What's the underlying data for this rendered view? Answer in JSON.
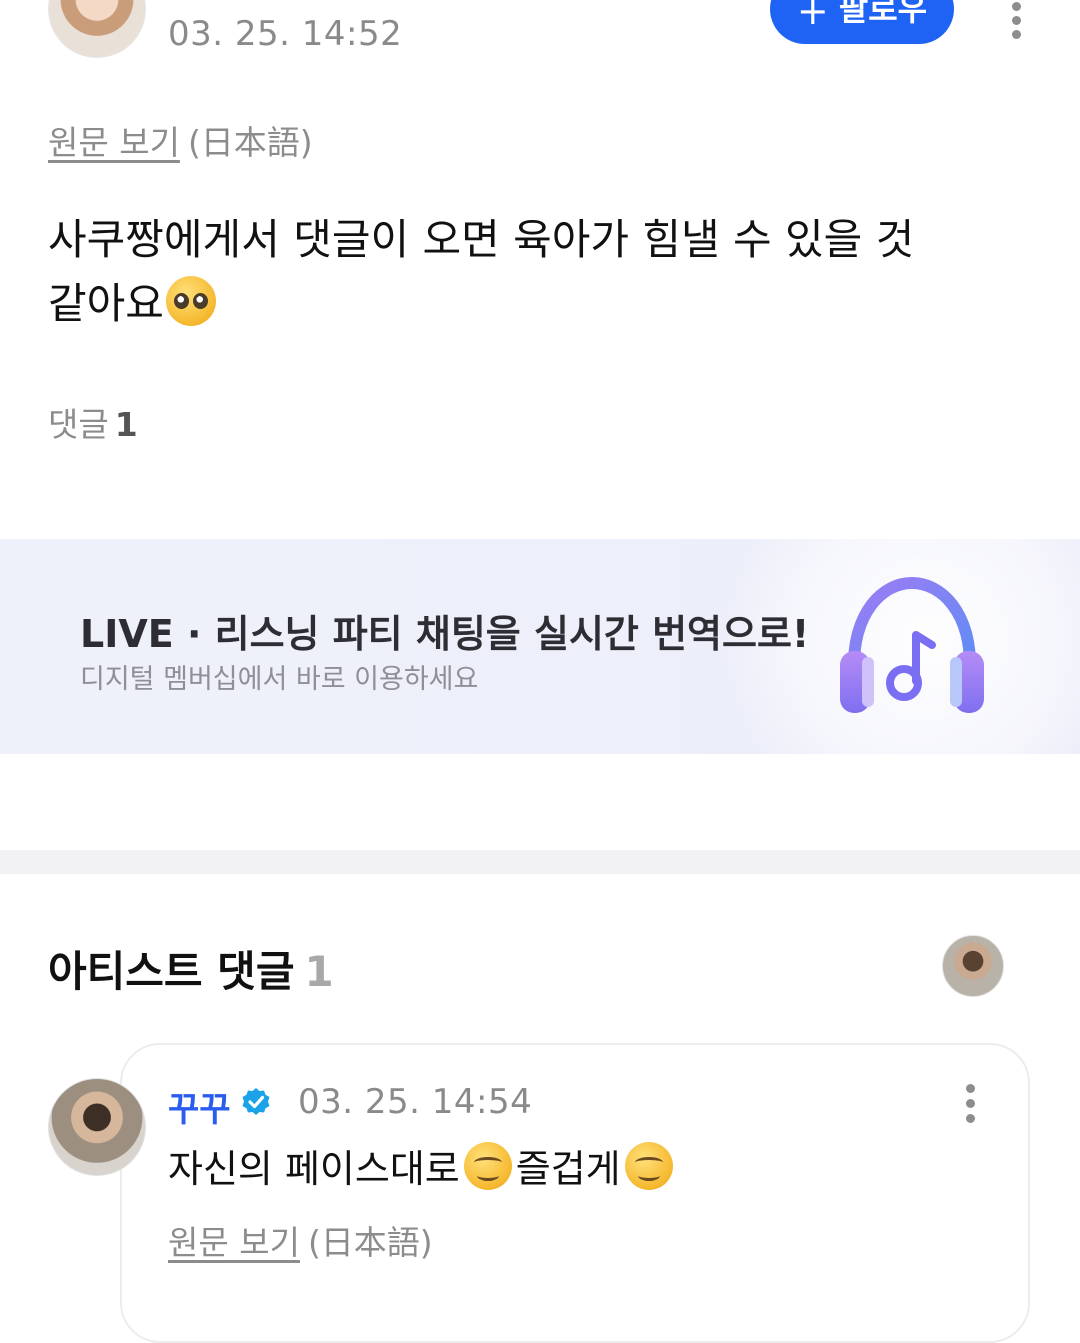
{
  "post": {
    "time": "03. 25. 14:52",
    "follow_label": "팔로우",
    "follow_icon": "plus-icon",
    "view_original": "원문 보기",
    "original_lang": "(日本語)",
    "body_line1": "사쿠짱에게서 댓글이 오면 육아가 힘낼 수 있을 것",
    "body_line2": "같아요",
    "body_emoji": "pleading-face-emoji",
    "comments_label": "댓글",
    "comments_count": "1"
  },
  "banner": {
    "title": "LIVE · 리스닝 파티 채팅을 실시간 번역으로!",
    "subtitle": "디지털 멤버십에서 바로 이용하세요",
    "icon": "headphones-music-icon"
  },
  "artist_comments": {
    "title": "아티스트 댓글",
    "count": "1",
    "comment": {
      "author": "꾸꾸",
      "time": "03. 25. 14:54",
      "text_part1": "자신의 페이스대로",
      "text_part2": "즐겁게",
      "emoji": "smiling-face-emoji",
      "view_original": "원문 보기",
      "original_lang": "(日本語)"
    }
  },
  "colors": {
    "accent": "#1f63f5",
    "artist_name": "#2a5cf0",
    "verified": "#1aa3e8",
    "muted": "#8c8c8c"
  }
}
